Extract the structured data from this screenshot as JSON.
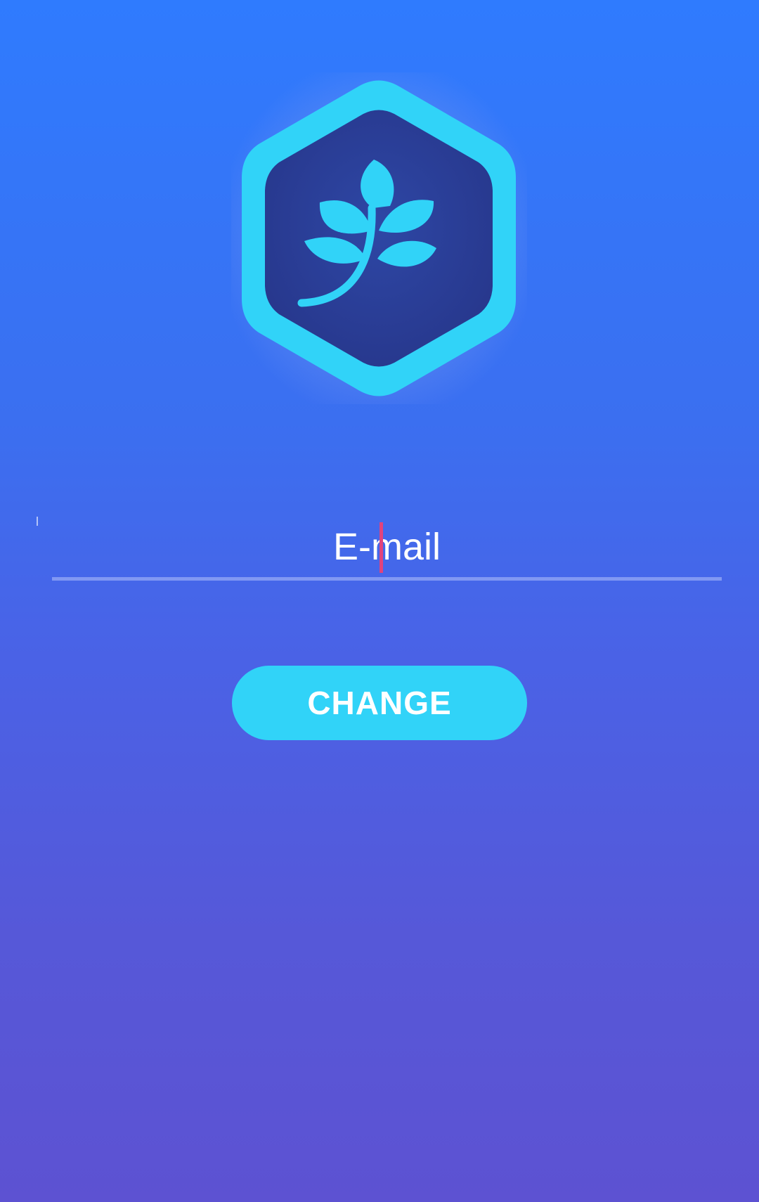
{
  "logo": {
    "icon": "leaf-branch-hexagon-logo",
    "accent_color": "#31d3f8",
    "inner_color": "#293d95"
  },
  "form": {
    "email_placeholder": "E-mail",
    "email_value": ""
  },
  "actions": {
    "change_label": "CHANGE"
  },
  "colors": {
    "background_top": "#2f7bfe",
    "background_bottom": "#5d52d2",
    "button": "#31d3f8",
    "caret": "#e0437d"
  }
}
